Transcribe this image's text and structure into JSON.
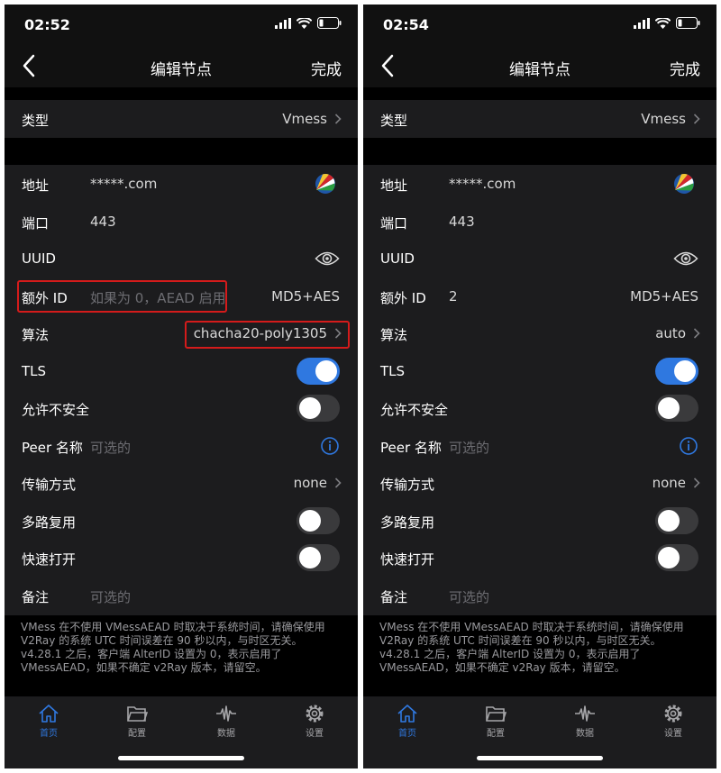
{
  "common": {
    "nav_title": "编辑节点",
    "done_label": "完成",
    "rows": {
      "type_label": "类型",
      "type_value": "Vmess",
      "address_label": "地址",
      "address_value": "*****.com",
      "port_label": "端口",
      "port_value": "443",
      "uuid_label": "UUID",
      "alterid_label": "额外 ID",
      "algorithm_label": "算法",
      "tls_label": "TLS",
      "insecure_label": "允许不安全",
      "peer_label": "Peer 名称",
      "peer_placeholder": "可选的",
      "transport_label": "传输方式",
      "transport_value": "none",
      "mux_label": "多路复用",
      "fastopen_label": "快速打开",
      "remark_label": "备注",
      "remark_placeholder": "可选的"
    },
    "note_lines": [
      "VMess 在不使用 VMessAEAD 时取决于系统时间，请确保使用",
      "V2Ray 的系统 UTC 时间误差在 90 秒以内，与时区无关。",
      "v4.28.1 之后，客户端 AlterID 设置为 0，表示启用了",
      "VMessAEAD，如果不确定 v2Ray 版本，请留空。"
    ],
    "tabs": [
      "首页",
      "配置",
      "数据",
      "设置"
    ],
    "accent_color": "#2f78e0",
    "highlight_color": "#d41b1b"
  },
  "left": {
    "time": "02:52",
    "alterid_placeholder": "如果为 0，AEAD 启用",
    "security_value": "MD5+AES",
    "algorithm_value": "chacha20-poly1305",
    "toggles": {
      "tls": true,
      "insecure": false,
      "mux": false,
      "fastopen": false
    }
  },
  "right": {
    "time": "02:54",
    "alterid_value": "2",
    "security_value": "MD5+AES",
    "algorithm_value": "auto",
    "toggles": {
      "tls": true,
      "insecure": false,
      "mux": false,
      "fastopen": false
    }
  }
}
